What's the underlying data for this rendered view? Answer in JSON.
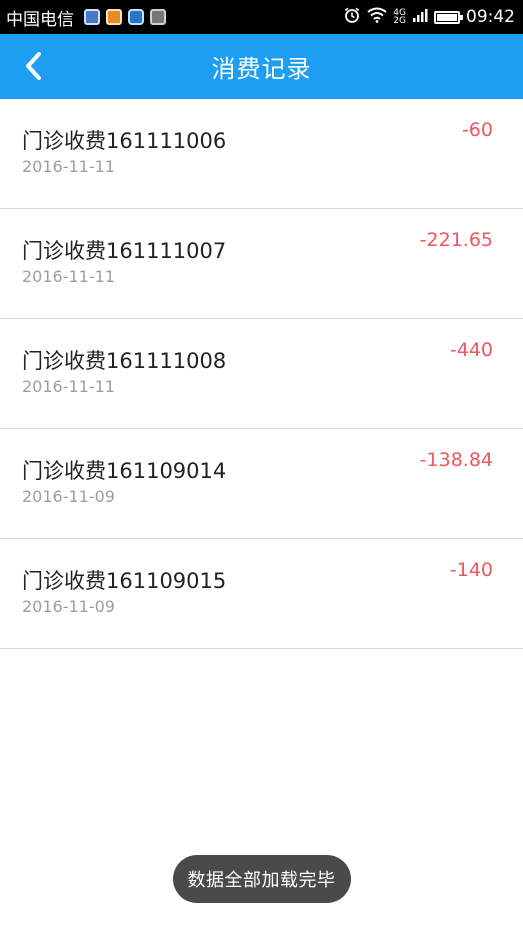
{
  "status_bar": {
    "carrier": "中国电信",
    "network_label_top": "4G",
    "network_label_bottom": "2G",
    "time": "09:42",
    "icons": [
      "notification-app-icon",
      "notification-app-icon",
      "notification-app-icon",
      "notification-app-icon",
      "alarm-icon",
      "wifi-icon",
      "signal-icon",
      "battery-icon"
    ]
  },
  "app_bar": {
    "title": "消费记录",
    "back_icon": "chevron-left-icon",
    "background_color": "#1e9ef3"
  },
  "records": [
    {
      "name": "门诊收费161111006",
      "date": "2016-11-11",
      "amount": "-60"
    },
    {
      "name": "门诊收费161111007",
      "date": "2016-11-11",
      "amount": "-221.65"
    },
    {
      "name": "门诊收费161111008",
      "date": "2016-11-11",
      "amount": "-440"
    },
    {
      "name": "门诊收费161109014",
      "date": "2016-11-09",
      "amount": "-138.84"
    },
    {
      "name": "门诊收费161109015",
      "date": "2016-11-09",
      "amount": "-140"
    }
  ],
  "toast": {
    "message": "数据全部加载完毕"
  },
  "colors": {
    "amount_negative": "#f0575c",
    "date_text": "#9e9e9e",
    "divider": "#dcdcdc"
  }
}
